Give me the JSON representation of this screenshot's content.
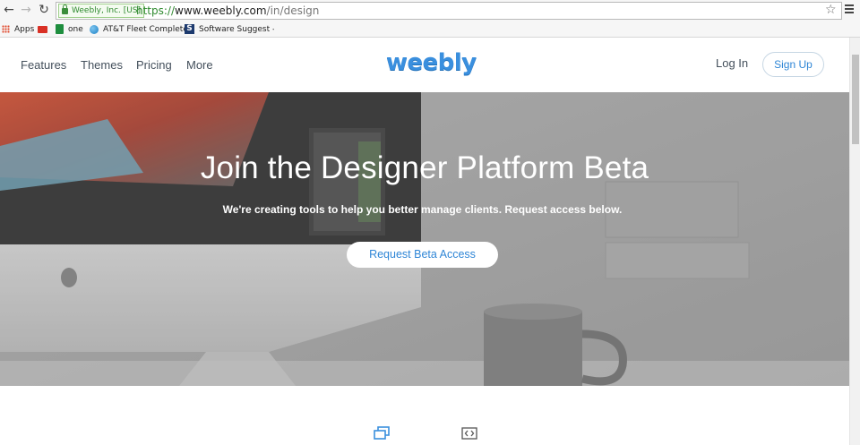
{
  "browser": {
    "security_label": "Weebly, Inc. [US]",
    "url_scheme": "https://",
    "url_host": "www.weebly.com",
    "url_path": "/in/design",
    "bookmarks": [
      {
        "label": "Apps",
        "icon": "apps-grid-icon"
      },
      {
        "label": "",
        "icon": "gmail-icon"
      },
      {
        "label": "one",
        "icon": "sheets-icon"
      },
      {
        "label": "AT&T Fleet Complete",
        "icon": "att-globe-icon"
      },
      {
        "label": "Software Suggest - U",
        "icon": "s-logo-icon"
      }
    ]
  },
  "header": {
    "nav": [
      "Features",
      "Themes",
      "Pricing",
      "More"
    ],
    "logo": "weebly",
    "login": "Log In",
    "signup": "Sign Up",
    "brand_color": "#3a8fde"
  },
  "hero": {
    "title": "Join the Designer Platform Beta",
    "subtitle": "We're creating tools to help you better manage clients. Request access below.",
    "cta": "Request Beta Access"
  },
  "features": {
    "icons": [
      "window-stack-icon",
      "code-brackets-icon"
    ]
  }
}
